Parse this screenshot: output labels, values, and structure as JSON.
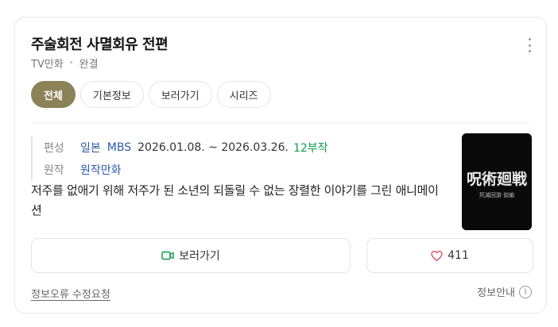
{
  "header": {
    "title": "주술회전 사멸회유 전편",
    "category": "TV만화",
    "status": "완결"
  },
  "tabs": [
    {
      "label": "전체",
      "active": true
    },
    {
      "label": "기본정보",
      "active": false
    },
    {
      "label": "보러가기",
      "active": false
    },
    {
      "label": "시리즈",
      "active": false
    }
  ],
  "info": {
    "broadcast_label": "편성",
    "country": "일본",
    "network": "MBS",
    "period": "2026.01.08. ~ 2026.03.26.",
    "episodes": "12부작",
    "original_label": "원작",
    "original": "원작만화"
  },
  "description": "저주를 없애기 위해 저주가 된 소년의 되돌릴 수 없는 장렬한 이야기를 그린 애니메이션",
  "poster": {
    "title_text": "呪術廻戦",
    "subtitle_text": "死滅回游 前編"
  },
  "actions": {
    "watch_label": "보러가기",
    "like_count": "411"
  },
  "footer": {
    "report_link": "정보오류 수정요청",
    "info_label": "정보안내",
    "info_icon_text": "i"
  },
  "colors": {
    "accent": "#8c8257",
    "link": "#2c5aa8",
    "green": "#119c4f",
    "heart": "#e04a5a"
  }
}
